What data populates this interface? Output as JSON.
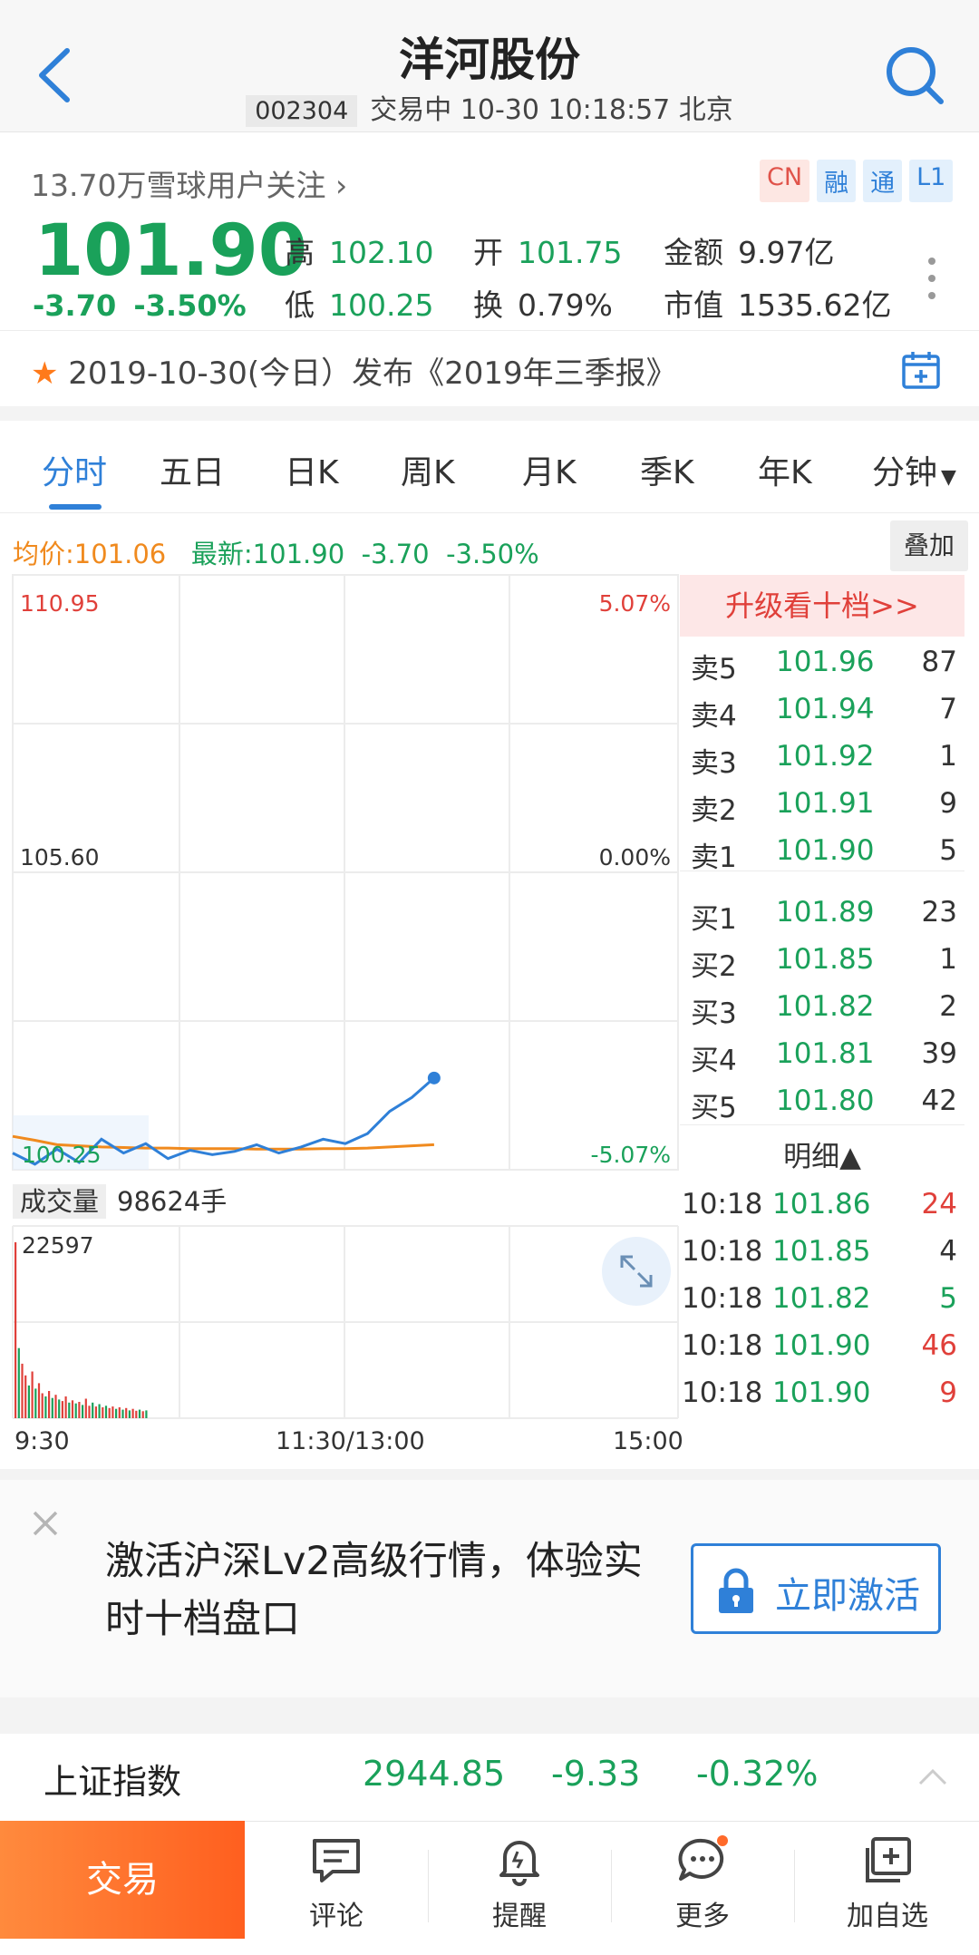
{
  "header": {
    "title": "洋河股份",
    "code": "002304",
    "status": "交易中 10-30 10:18:57 北京"
  },
  "quote": {
    "followers": "13.70万雪球用户关注",
    "badges": [
      "CN",
      "融",
      "通",
      "L1"
    ],
    "price": "101.90",
    "change": "-3.70",
    "change_pct": "-3.50%",
    "high_label": "高",
    "high": "102.10",
    "low_label": "低",
    "low": "100.25",
    "open_label": "开",
    "open": "101.75",
    "turnover_label": "换",
    "turnover": "0.79%",
    "amount_label": "金额",
    "amount": "9.97亿",
    "mktcap_label": "市值",
    "mktcap": "1535.62亿"
  },
  "event": {
    "text": "2019-10-30(今日）发布《2019年三季报》"
  },
  "tabs": [
    "分时",
    "五日",
    "日K",
    "周K",
    "月K",
    "季K",
    "年K",
    "分钟"
  ],
  "chart_header": {
    "avg": "均价:101.06",
    "latest": "最新:101.90",
    "chg": "-3.70",
    "chg_pct": "-3.50%",
    "overlay": "叠加"
  },
  "chart_data": {
    "type": "line",
    "price_labels": {
      "top": "110.95",
      "mid": "105.60",
      "bottom": "100.25"
    },
    "pct_labels": {
      "top": "5.07%",
      "mid": "0.00%",
      "bottom": "-5.07%"
    },
    "x_labels": [
      "9:30",
      "11:30/13:00",
      "15:00"
    ],
    "ylim": [
      100.25,
      110.95
    ],
    "series": [
      {
        "values": [
          100.55,
          100.35,
          100.62,
          100.38,
          100.8,
          100.55,
          100.72,
          100.45,
          100.6,
          100.52,
          100.58,
          100.7,
          100.55,
          100.66,
          100.8,
          100.72,
          100.9,
          101.3,
          101.55,
          101.9
        ]
      },
      {
        "values": [
          100.85,
          100.78,
          100.7,
          100.68,
          100.66,
          100.65,
          100.64,
          100.64,
          100.63,
          100.63,
          100.63,
          100.62,
          100.62,
          100.62,
          100.63,
          100.63,
          100.64,
          100.66,
          100.68,
          100.7
        ]
      }
    ],
    "volume": {
      "label": "成交量",
      "total": "98624手",
      "max_label": "22597",
      "max": 22597,
      "bars": [
        22597,
        9000,
        7000,
        5500,
        4200,
        6000,
        3800,
        4500,
        3200,
        2800,
        3500,
        2600,
        3000,
        2400,
        2200,
        2800,
        2000,
        2300,
        1900,
        2100,
        1700,
        2500,
        1600,
        2000,
        1500,
        1800,
        1400,
        1600,
        1300,
        1500,
        1200,
        1400,
        1100,
        1300,
        1000,
        1200,
        950,
        1100,
        900,
        1000
      ],
      "bar_colors": [
        "red",
        "green",
        "red",
        "red",
        "green",
        "red",
        "green",
        "red",
        "red",
        "green",
        "red",
        "green",
        "red",
        "green",
        "red",
        "red",
        "green",
        "red",
        "green",
        "red",
        "green",
        "red",
        "red",
        "green",
        "red",
        "green",
        "red",
        "green",
        "red",
        "red",
        "green",
        "red",
        "green",
        "red",
        "green",
        "red",
        "red",
        "green",
        "red",
        "green"
      ]
    }
  },
  "order_book": {
    "upgrade": "升级看十档>>",
    "asks": [
      {
        "label": "卖5",
        "price": "101.96",
        "vol": "87"
      },
      {
        "label": "卖4",
        "price": "101.94",
        "vol": "7"
      },
      {
        "label": "卖3",
        "price": "101.92",
        "vol": "1"
      },
      {
        "label": "卖2",
        "price": "101.91",
        "vol": "9"
      },
      {
        "label": "卖1",
        "price": "101.90",
        "vol": "5"
      }
    ],
    "bids": [
      {
        "label": "买1",
        "price": "101.89",
        "vol": "23"
      },
      {
        "label": "买2",
        "price": "101.85",
        "vol": "1"
      },
      {
        "label": "买3",
        "price": "101.82",
        "vol": "2"
      },
      {
        "label": "买4",
        "price": "101.81",
        "vol": "39"
      },
      {
        "label": "买5",
        "price": "101.80",
        "vol": "42"
      }
    ],
    "detail_label": "明细▲",
    "trades": [
      {
        "time": "10:18",
        "price": "101.86",
        "vol": "24",
        "side": "red"
      },
      {
        "time": "10:18",
        "price": "101.85",
        "vol": "4",
        "side": "dark"
      },
      {
        "time": "10:18",
        "price": "101.82",
        "vol": "5",
        "side": "green"
      },
      {
        "time": "10:18",
        "price": "101.90",
        "vol": "46",
        "side": "red"
      },
      {
        "time": "10:18",
        "price": "101.90",
        "vol": "9",
        "side": "red"
      }
    ]
  },
  "banner": {
    "text": "激活沪深Lv2高级行情，体验实时十档盘口",
    "button": "立即激活"
  },
  "index_bar": {
    "name": "上证指数",
    "value": "2944.85",
    "change": "-9.33",
    "pct": "-0.32%"
  },
  "bottom_nav": {
    "trade": "交易",
    "items": [
      "评论",
      "提醒",
      "更多",
      "加自选"
    ]
  },
  "colors": {
    "up": "#e0403a",
    "down": "#1aa15a",
    "accent": "#2f80d8",
    "avg_line": "#f08a1e",
    "price_line": "#2f80d8",
    "trade_btn": "#ff6a2a"
  }
}
